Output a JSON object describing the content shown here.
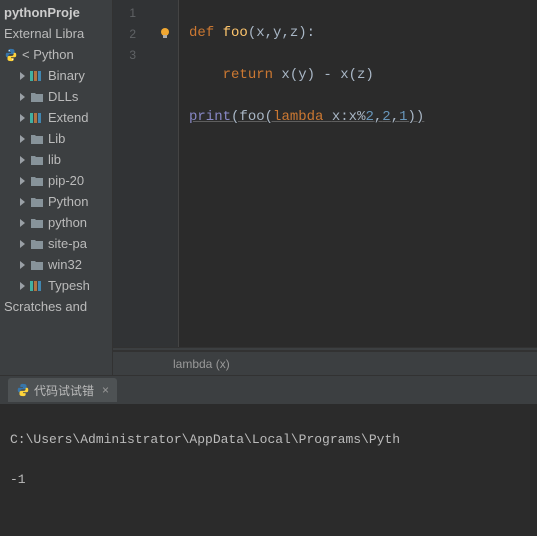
{
  "sidebar": {
    "project": "pythonProje",
    "external": "External Libra",
    "python": "< Python",
    "items": [
      {
        "label": "Binary",
        "icon": "lib"
      },
      {
        "label": "DLLs",
        "icon": "folder"
      },
      {
        "label": "Extend",
        "icon": "lib"
      },
      {
        "label": "Lib",
        "icon": "folder"
      },
      {
        "label": "lib",
        "icon": "folder"
      },
      {
        "label": "pip-20",
        "icon": "folder"
      },
      {
        "label": "Python",
        "icon": "folder"
      },
      {
        "label": "python",
        "icon": "folder"
      },
      {
        "label": "site-pa",
        "icon": "folder"
      },
      {
        "label": "win32",
        "icon": "folder"
      },
      {
        "label": "Typesh",
        "icon": "lib"
      }
    ],
    "scratches": "Scratches and"
  },
  "gutter": {
    "lines": [
      "1",
      "2",
      "3"
    ]
  },
  "code": {
    "line1": {
      "def": "def ",
      "fn": "foo",
      "paren_open": "(",
      "params": "x,y,z",
      "paren_close": "):"
    },
    "line2": {
      "indent": "    ",
      "ret": "return ",
      "expr": "x(y) - x(z)"
    },
    "line3": {
      "print": "print",
      "po": "(",
      "foo": "foo",
      "po2": "(",
      "lam": "lambda ",
      "lamexpr": "x:x%",
      "n2": "2",
      "c1": ",",
      "n2b": "2",
      "c2": ",",
      "n1": "1",
      "pc": "))"
    }
  },
  "breadcrumb": "lambda (x)",
  "terminal": {
    "tab": "代码试试错",
    "line1": "C:\\Users\\Administrator\\AppData\\Local\\Programs\\Pyth",
    "line2": "-1"
  }
}
